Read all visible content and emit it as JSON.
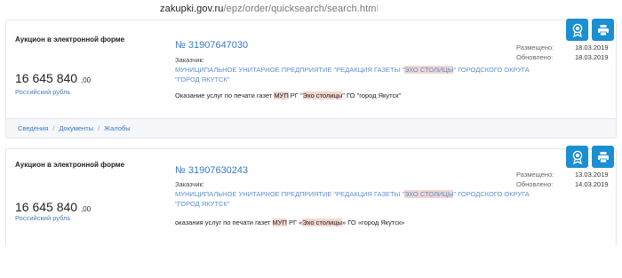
{
  "address_bar": {
    "host": "zakupki.gov.ru",
    "path": "/epz/order/quicksearch/search.htm",
    "fade": "l"
  },
  "cards": [
    {
      "type": "Аукцион в электронной форме",
      "number": "№ 31907647030",
      "customer_label": "Заказчик:",
      "customer": {
        "pre": "МУНИЦИПАЛЬНОЕ УНИТАРНОЕ ПРЕДПРИЯТИЕ \"РЕДАКЦИЯ ГАЗЕТЫ \"",
        "hl": "ЭХО СТОЛИЦЫ",
        "post": "\" ГОРОДСКОГО ОКРУГА \"ГОРОД ЯКУТСК\""
      },
      "subject": {
        "p1": "Оказание услуг по печати газет ",
        "h1": "МУП",
        "p2": " РГ \"",
        "h2": "Эхо столицы",
        "p3": "\" ГО \"город Якутск\""
      },
      "price": {
        "main": "16 645 840",
        "cents": ",00"
      },
      "currency": "Российский рубль",
      "posted_label": "Размещено:",
      "posted": "18.03.2019",
      "updated_label": "Обновлено:",
      "updated": "18.03.2019",
      "links": [
        "Сведения",
        "Документы",
        "Жалобы"
      ]
    },
    {
      "type": "Аукцион в электронной форме",
      "number": "№ 31907630243",
      "customer_label": "Заказчик:",
      "customer": {
        "pre": "МУНИЦИПАЛЬНОЕ УНИТАРНОЕ ПРЕДПРИЯТИЕ \"РЕДАКЦИЯ ГАЗЕТЫ \"",
        "hl": "ЭХО СТОЛИЦЫ",
        "post": "\" ГОРОДСКОГО ОКРУГА \"ГОРОД ЯКУТСК\""
      },
      "subject": {
        "p1": "оказания услуг по печати газет ",
        "h1": "МУП",
        "p2": " РГ «",
        "h2": "Эхо столицы",
        "p3": "» ГО «город Якутск»"
      },
      "price": {
        "main": "16 645 840",
        "cents": ",00"
      },
      "currency": "Российский рубль",
      "posted_label": "Размещено:",
      "posted": "13.03.2019",
      "updated_label": "Обновлено:",
      "updated": "14.03.2019"
    }
  ],
  "icons": {
    "award": "award-icon",
    "print": "print-icon",
    "accent": "#1a8fd2",
    "highlight": "#f4d6cf",
    "link": "#3a78c4"
  }
}
